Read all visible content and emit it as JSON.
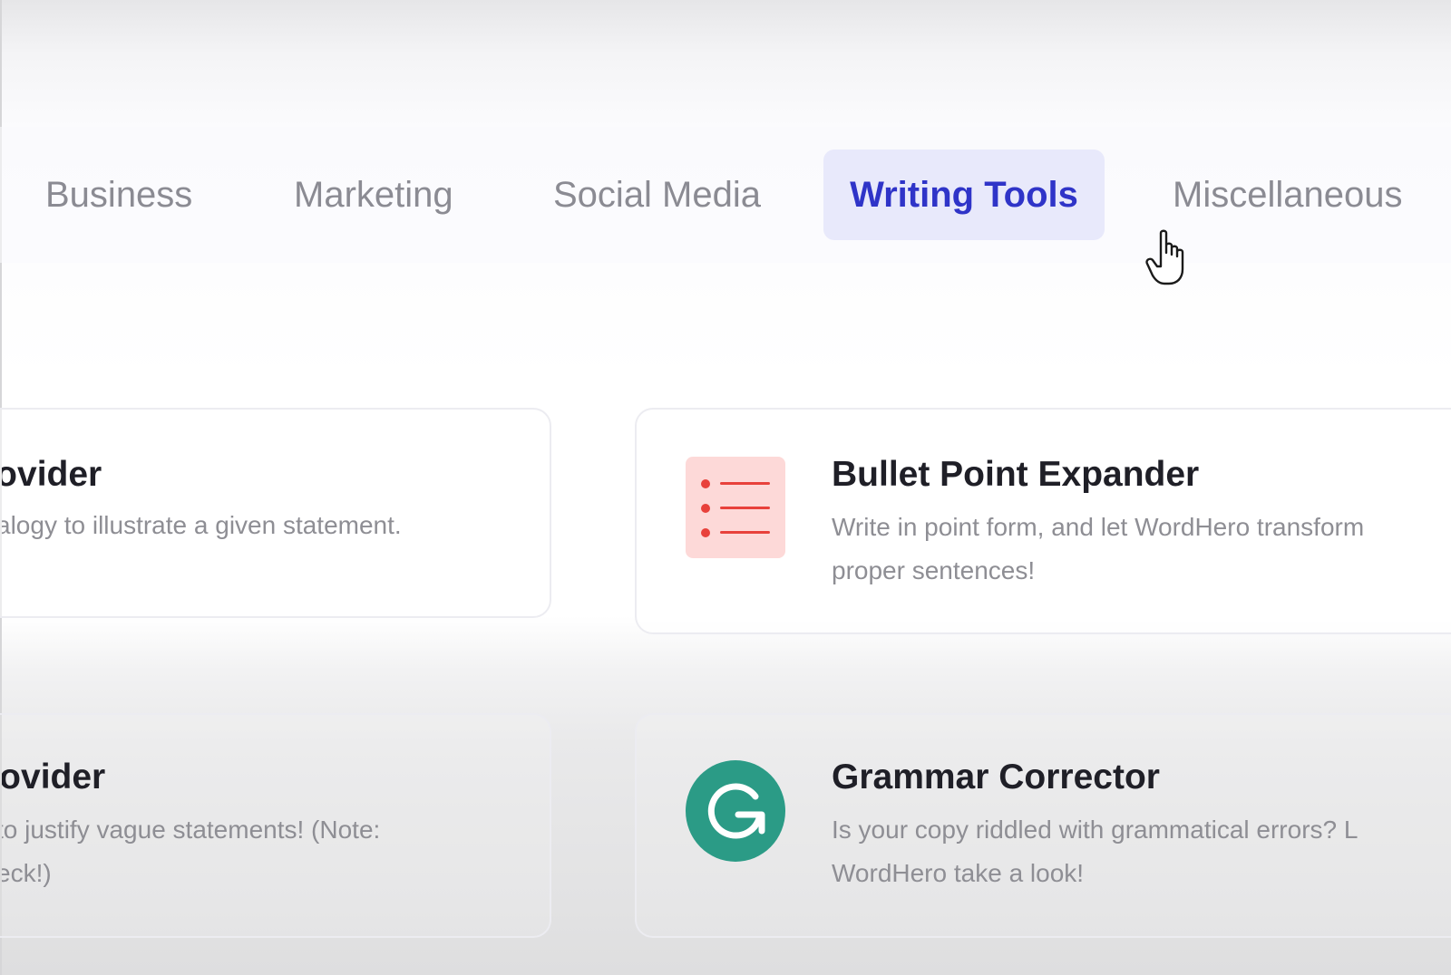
{
  "tabs": [
    {
      "label": "Business",
      "active": false
    },
    {
      "label": "Marketing",
      "active": false
    },
    {
      "label": "Social Media",
      "active": false
    },
    {
      "label": "Writing Tools",
      "active": true
    },
    {
      "label": "Miscellaneous",
      "active": false
    }
  ],
  "cards": {
    "left_top": {
      "title": "rovider",
      "description": [
        "alogy to illustrate a given statement."
      ]
    },
    "left_bottom": {
      "title": "rovider",
      "description": [
        "to justify vague statements! (Note:",
        "eck!)"
      ]
    },
    "right_top": {
      "title": "Bullet Point Expander",
      "description": [
        "Write in point form, and let WordHero transform",
        "proper sentences!"
      ],
      "icon": "bullet-list-icon"
    },
    "right_bottom": {
      "title": "Grammar Corrector",
      "description": [
        "Is your copy riddled with grammatical errors? L",
        "WordHero take a look!"
      ],
      "icon": "grammar-g-icon"
    }
  },
  "colors": {
    "active_tab_bg": "#e8e9fb",
    "active_tab_text": "#2f34c8",
    "inactive_tab_text": "#8b8b93",
    "bullet_icon_bg": "#fdd9d8",
    "bullet_icon_fg": "#e8413b",
    "grammar_icon_bg": "#2b9b86"
  }
}
